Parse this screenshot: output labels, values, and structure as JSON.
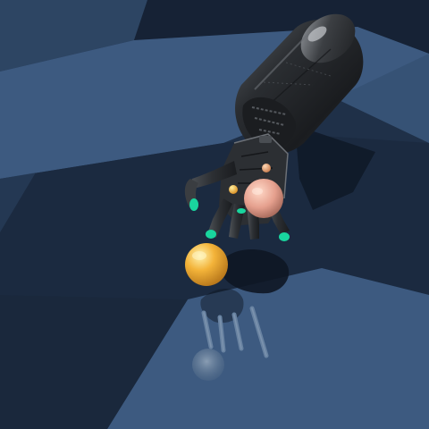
{
  "scene": {
    "type": "3d-simulation-render",
    "floor": {
      "pattern": "checkerboard",
      "colors": {
        "light": "#3d5a80",
        "dark": "#1b2a40"
      }
    },
    "robot": {
      "kind": "dexterous-robot-hand",
      "colors": {
        "body": "#2a2d31",
        "highlight": "#6c7076",
        "joint_markers": "#19d59e"
      }
    },
    "objects": [
      {
        "name": "target-sphere",
        "color": "#f0a93a"
      },
      {
        "name": "goal-sphere",
        "color": "#e6a08f"
      },
      {
        "name": "marker-sphere-small",
        "color": "#e8a070"
      },
      {
        "name": "marker-sphere-tiny",
        "color": "#f2b44a"
      }
    ]
  }
}
